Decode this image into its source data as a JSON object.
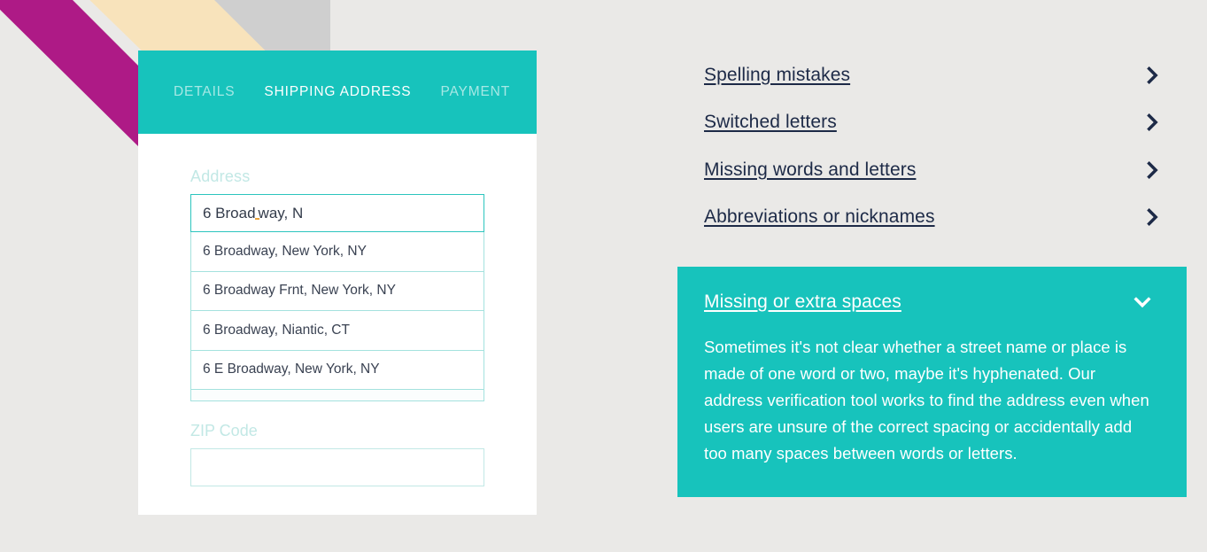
{
  "theme": {
    "background": "#eae9e7",
    "teal": "#17c3bc",
    "teal_light_border": "#a4e2de",
    "label_teal": "#c2e8e5",
    "magenta": "#ae1a86",
    "cream": "#f8e3bb",
    "gray_band": "#cfcfcf",
    "navy": "#1d2a47",
    "typo_marker": "#e8a33d"
  },
  "decorations": [
    {
      "name": "magenta-diagonal-band",
      "color": "#ae1a86"
    },
    {
      "name": "cream-diagonal-band",
      "color": "#f8e3bb"
    },
    {
      "name": "gray-diagonal-band",
      "color": "#cfcfcf"
    }
  ],
  "checkout": {
    "tabs": [
      {
        "label": "DETAILS",
        "active": false
      },
      {
        "label": "SHIPPING ADDRESS",
        "active": true
      },
      {
        "label": "PAYMENT",
        "active": false
      }
    ],
    "address": {
      "label": "Address",
      "value_before_typo": "6 Broad",
      "value_after_typo": "way, N",
      "full_value": "6 Broad way, N",
      "placeholder": "Address"
    },
    "suggestions": [
      "6 Broadway, New York, NY",
      "6 Broadway Frnt, New York, NY",
      "6 Broadway, Niantic, CT",
      "6 E Broadway, New York, NY"
    ],
    "zip": {
      "label": "ZIP Code",
      "value": "",
      "placeholder": ""
    }
  },
  "accordion": {
    "collapsed_items": [
      {
        "title": "Spelling mistakes",
        "icon": "chevron-right-icon"
      },
      {
        "title": "Switched letters",
        "icon": "chevron-right-icon"
      },
      {
        "title": "Missing words and letters",
        "icon": "chevron-right-icon"
      },
      {
        "title": "Abbreviations or nicknames",
        "icon": "chevron-right-icon"
      }
    ],
    "expanded": {
      "title": "Missing or extra spaces",
      "icon": "chevron-down-icon",
      "body": "Sometimes it's not clear whether a street name or place is made of one word or two, maybe it's hyphenated. Our address verification tool works to find the address even when users are unsure of the correct spacing or accidentally add too many spaces between words or letters."
    }
  }
}
